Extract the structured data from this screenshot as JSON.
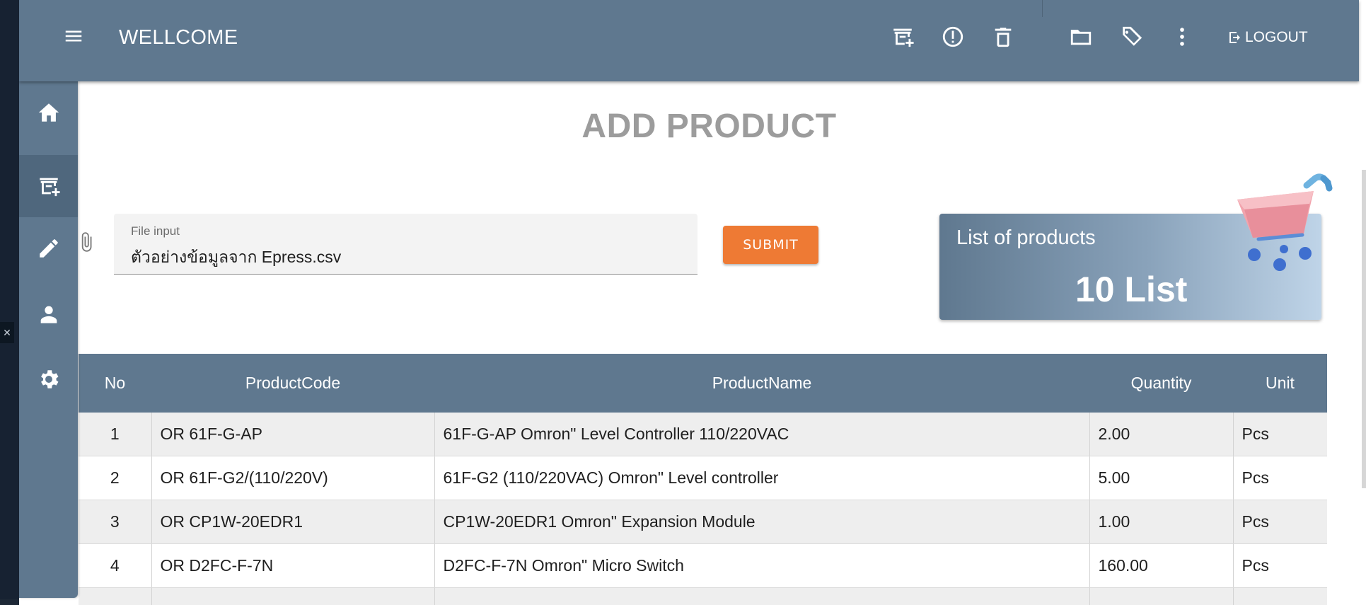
{
  "header": {
    "title": "WELLCOME",
    "logout_label": "LOGOUT",
    "icons": [
      "menu-icon",
      "add-product-icon",
      "alert-icon",
      "delete-icon",
      "folder-icon",
      "tag-icon",
      "more-vert-icon",
      "logout-icon"
    ]
  },
  "sidebar": {
    "items": [
      {
        "icon": "home-icon",
        "active": false
      },
      {
        "icon": "add-product-icon",
        "active": true
      },
      {
        "icon": "edit-icon",
        "active": false
      },
      {
        "icon": "user-icon",
        "active": false
      },
      {
        "icon": "settings-icon",
        "active": false
      }
    ]
  },
  "main": {
    "title": "ADD PRODUCT",
    "file_input": {
      "label": "File input",
      "value": "ตัวอย่างข้อมูลจาก Epress.csv"
    },
    "submit_label": "SUBMIT",
    "card": {
      "title": "List of products",
      "count": "10 List"
    }
  },
  "table": {
    "headers": [
      "No",
      "ProductCode",
      "ProductName",
      "Quantity",
      "Unit"
    ],
    "rows": [
      {
        "no": "1",
        "code": "OR 61F-G-AP",
        "name": "61F-G-AP Omron\" Level Controller 110/220VAC",
        "qty": "2.00",
        "unit": "Pcs"
      },
      {
        "no": "2",
        "code": "OR 61F-G2/(110/220V)",
        "name": "61F-G2 (110/220VAC) Omron\" Level controller",
        "qty": "5.00",
        "unit": "Pcs"
      },
      {
        "no": "3",
        "code": "OR CP1W-20EDR1",
        "name": "CP1W-20EDR1 Omron\" Expansion Module",
        "qty": "1.00",
        "unit": "Pcs"
      },
      {
        "no": "4",
        "code": "OR D2FC-F-7N",
        "name": "D2FC-F-7N Omron\" Micro Switch",
        "qty": "160.00",
        "unit": "Pcs"
      }
    ]
  },
  "colors": {
    "primary": "#5f788f",
    "accent": "#ee7a34",
    "title_gray": "#9c9c9c"
  }
}
